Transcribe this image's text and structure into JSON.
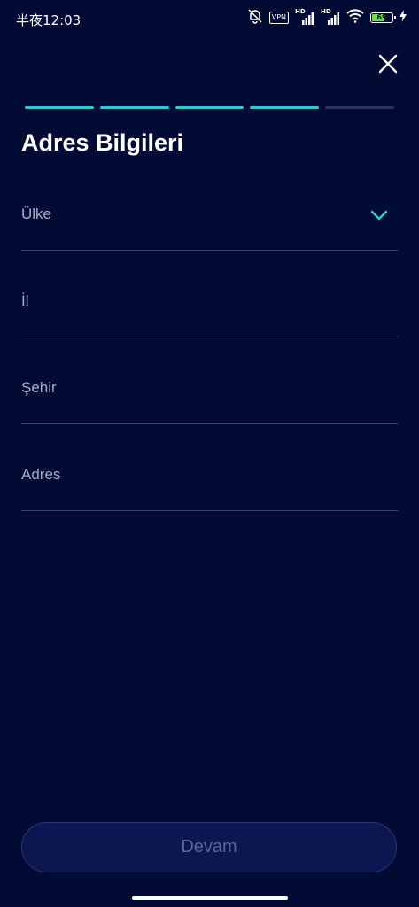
{
  "status_bar": {
    "time": "半夜12:03",
    "vpn_label": "VPN",
    "hd1": "HD",
    "hd2": "HD",
    "battery_level": "69",
    "battery_fraction": 0.69,
    "battery_color": "#6ae04c"
  },
  "progress": {
    "total_steps": 5,
    "completed_steps": 4,
    "active_color": "#2ec7d6",
    "inactive_color": "#2a3360"
  },
  "page": {
    "title": "Adres Bilgileri"
  },
  "form": {
    "country": {
      "label": "Ülke",
      "icon": "chevron-down-icon"
    },
    "il": {
      "label": "İl"
    },
    "sehir": {
      "label": "Şehir"
    },
    "adres": {
      "label": "Adres"
    }
  },
  "actions": {
    "continue_label": "Devam"
  },
  "colors": {
    "background": "#020b33",
    "accent": "#2ec7d6",
    "button_text": "#5d6797"
  }
}
